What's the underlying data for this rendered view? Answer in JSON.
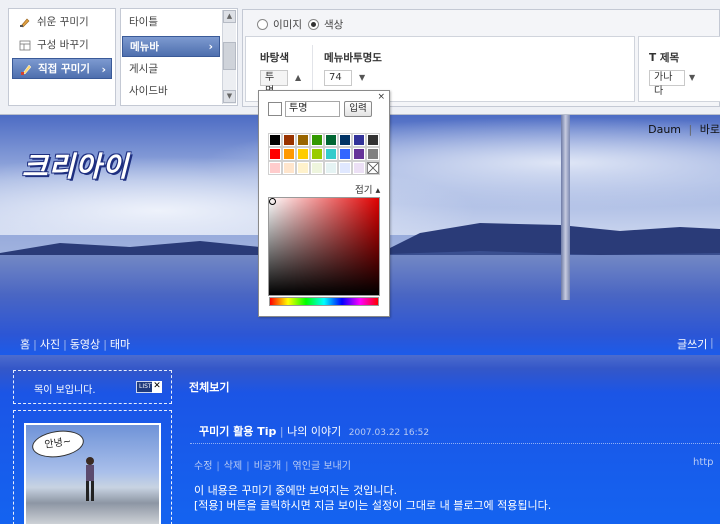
{
  "left_menu": {
    "items": [
      {
        "label": "쉬운 꾸미기",
        "icon": "brush-icon"
      },
      {
        "label": "구성 바꾸기",
        "icon": "layout-icon"
      },
      {
        "label": "직접 꾸미기",
        "icon": "paintbrush-icon",
        "active": true
      }
    ]
  },
  "sub_menu": {
    "items": [
      {
        "label": "타이틀"
      },
      {
        "label": "메뉴바",
        "active": true
      },
      {
        "label": "게시글"
      },
      {
        "label": "사이드바"
      }
    ]
  },
  "settings": {
    "radio_image": "이미지",
    "radio_color": "색상",
    "bg_color_label": "바탕색",
    "bg_color_value": "투명",
    "opacity_label": "메뉴바투명도",
    "opacity_value": "74",
    "font_label": "T 제목",
    "font_value": "가나다"
  },
  "picker": {
    "input_value": "투명",
    "enter_button": "입력",
    "fold_label": "접기",
    "close": "×",
    "swatches_row1": [
      "#000000",
      "#993300",
      "#996600",
      "#339900",
      "#006633",
      "#003366",
      "#333399",
      "#333333"
    ],
    "swatches_row2": [
      "#ff0000",
      "#ff9900",
      "#ffcc00",
      "#99cc00",
      "#33cccc",
      "#3366ff",
      "#663399",
      "#808080"
    ],
    "swatches_row3": [
      "#ffcccc",
      "#ffe5cc",
      "#fff2cc",
      "#eef5dd",
      "#e5f3f3",
      "#e0e8ff",
      "#ece0f5",
      "transparent"
    ]
  },
  "blog": {
    "title": "크리아이",
    "top_links": [
      "Daum",
      "바로"
    ],
    "nav": [
      "홈",
      "사진",
      "동영상",
      "태마"
    ],
    "write_link": "글쓰기",
    "notice": "목이 보입니다.",
    "notice_list": "LIST",
    "bubble": "안녕~",
    "post_header": "전체보기",
    "post_title": "꾸미기 활용 Tip",
    "post_category": "나의 이야기",
    "post_date": "2007.03.22 16:52",
    "post_actions": [
      "수정",
      "삭제",
      "비공개",
      "엮인글 보내기"
    ],
    "post_url": "http",
    "post_body_1": "이 내용은 꾸미기 중에만 보여지는 것입니다.",
    "post_body_2": "[적용] 버튼을 클릭하시면 지금 보이는 설정이 그대로 내 블로그에 적용됩니다."
  }
}
